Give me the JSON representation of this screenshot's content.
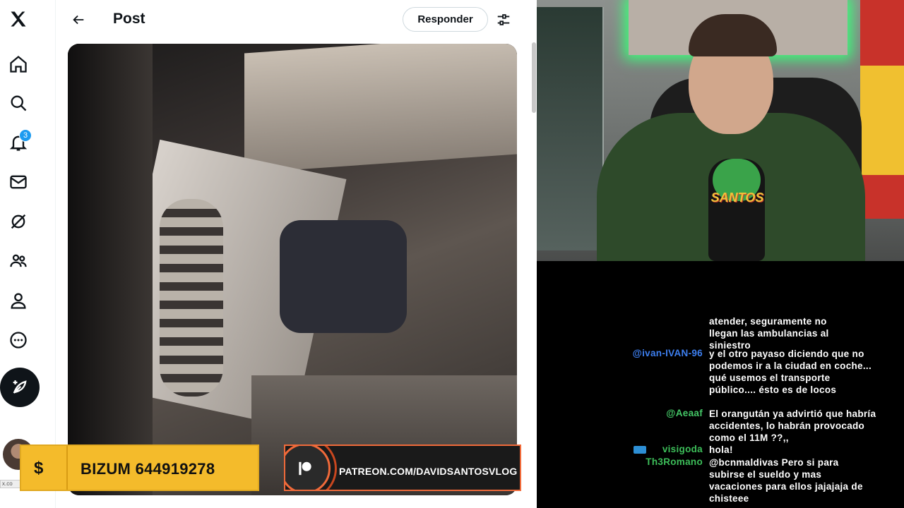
{
  "header": {
    "title": "Post",
    "reply_label": "Responder"
  },
  "nav": {
    "notifications_badge": "3"
  },
  "status_url": "x.co",
  "banners": {
    "bizum_symbol": "$",
    "bizum_text": "BIZUM 644919278",
    "patreon_text": "PATREON.COM/DAVIDSANTOSVLOG"
  },
  "webcam": {
    "mic_logo_text": "SANTOS"
  },
  "chat": {
    "messages": [
      {
        "user": "",
        "user_color": "#ffffff",
        "text": "atender, seguramente no llegan las ambulancias al siniestro"
      },
      {
        "user": "@ivan-IVAN-96",
        "user_color": "#3d7ff0",
        "text": "y el otro payaso diciendo que no podemos ir a la ciudad en coche... qué usemos el transporte público.... ésto es de locos"
      },
      {
        "user": "@Aeaaf",
        "user_color": "#44c767",
        "text": "El orangután ya advirtió que habría accidentes, lo habrán provocado como el 11M ??,,"
      },
      {
        "user": "visigoda",
        "user_color": "#3dbf5a",
        "text": "hola!"
      },
      {
        "user": "Th3Romano",
        "user_color": "#3dbf5a",
        "text": "@bcnmaldivas Pero si para subirse el sueldo y mas vacaciones para ellos jajajaja de chisteee"
      }
    ]
  },
  "colors": {
    "accent": "#1d9bf0",
    "bizum_yellow": "#f4bb2b",
    "patreon_orange": "#f06a3a"
  }
}
